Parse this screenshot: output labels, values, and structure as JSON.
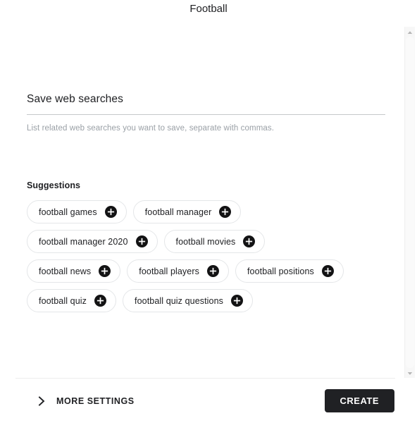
{
  "dialog": {
    "title": "Football"
  },
  "field": {
    "label": "Save web searches",
    "helper": "List related web searches you want to save, separate with commas.",
    "value": "",
    "placeholder": ""
  },
  "suggestions": {
    "heading": "Suggestions",
    "add_icon": "plus-circle-icon",
    "chips": [
      {
        "label": "football games"
      },
      {
        "label": "football manager"
      },
      {
        "label": "football manager 2020"
      },
      {
        "label": "football movies"
      },
      {
        "label": "football news"
      },
      {
        "label": "football players"
      },
      {
        "label": "football positions"
      },
      {
        "label": "football quiz"
      },
      {
        "label": "football quiz questions"
      }
    ]
  },
  "scrollbar": {
    "up_icon": "triangle-up-icon",
    "down_icon": "triangle-down-icon"
  },
  "footer": {
    "more_settings_label": "MORE SETTINGS",
    "more_settings_icon": "chevron-right-icon",
    "create_label": "CREATE"
  },
  "colors": {
    "accent": "#202124",
    "chip_border": "#e4e6e8",
    "helper_text": "#9aa0a6",
    "underline": "#c6c8ca",
    "scrollbar_track": "#f7f7f7"
  }
}
